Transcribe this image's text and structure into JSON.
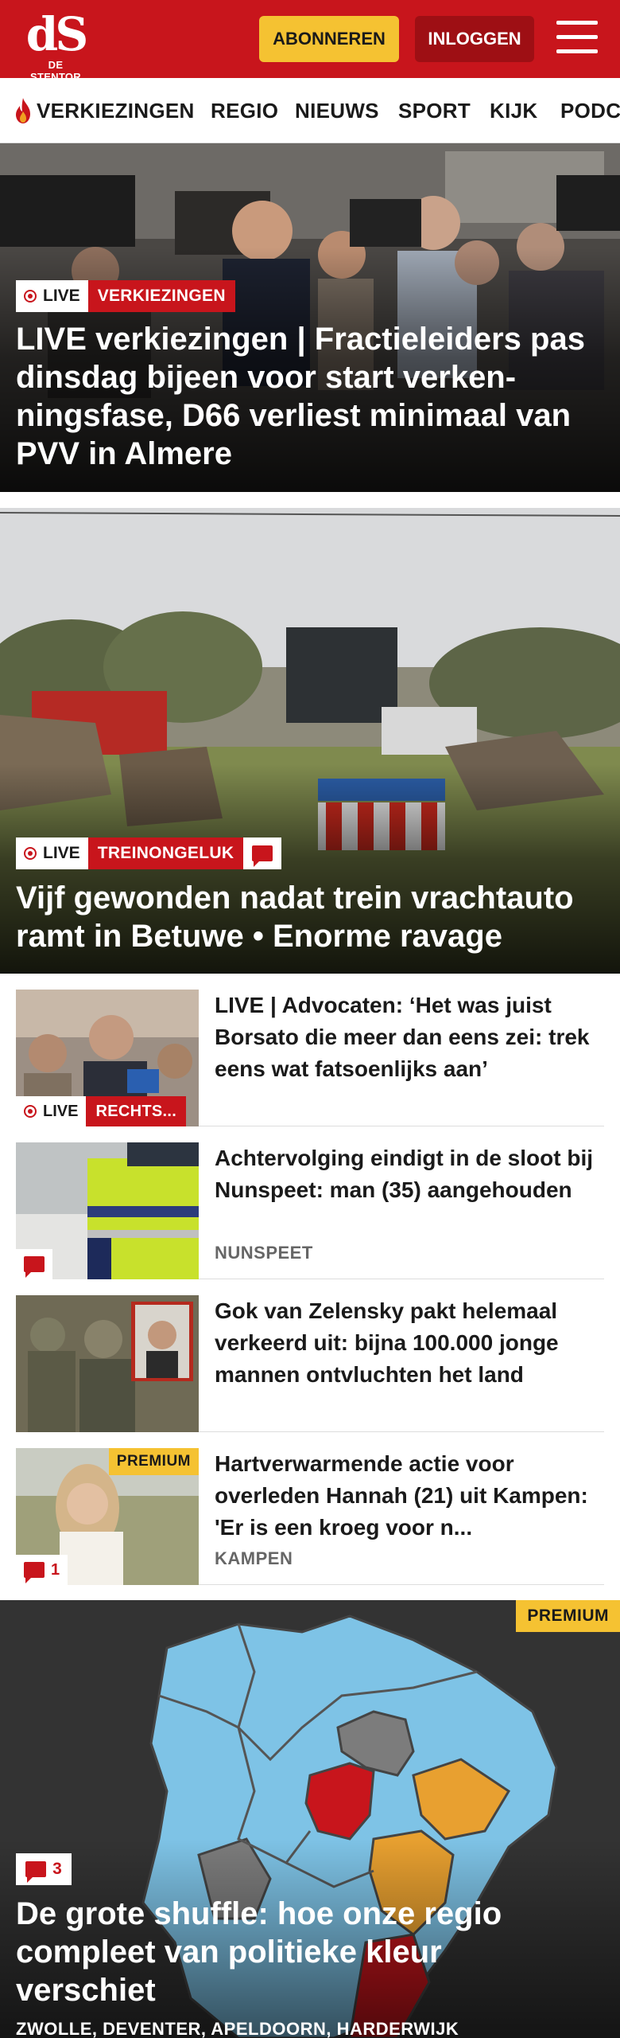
{
  "header": {
    "logo_mark": "dS",
    "logo_sub": "DE STENTOR",
    "subscribe_label": "ABONNEREN",
    "login_label": "INLOGGEN"
  },
  "nav": {
    "items": [
      "VERKIEZINGEN",
      "REGIO",
      "NIEUWS",
      "SPORT",
      "KIJK",
      "PODC"
    ]
  },
  "hero1": {
    "live_label": "LIVE",
    "category": "VERKIEZINGEN",
    "title": "LIVE verkiezingen | Fractieleiders pas dinsdag bijeen voor start verken­ningsfase, D66 verliest minimaal van PVV in Almere"
  },
  "hero2": {
    "live_label": "LIVE",
    "category": "TREINONGELUK",
    "title": "Vijf gewonden nadat trein vrachtauto ramt in Betuwe • Enorme ravage",
    "icon": "comment-icon"
  },
  "articles": [
    {
      "headline": "LIVE | Advocaten: ‘Het was juist Borsato die meer dan eens zei: trek eens wat fatsoenlijks aan’",
      "live_label": "LIVE",
      "category": "RECHTS..."
    },
    {
      "headline": "Achtervolging eindigt in de sloot bij Nunspeet: man (35) aangehou­den",
      "location": "NUNSPEET"
    },
    {
      "headline": "Gok van Zelensky pakt helemaal verkeerd uit: bijna 100.000 jonge mannen ontvluchten het land"
    },
    {
      "headline": "Hartverwarmende actie voor overleden Hannah (21) uit Kampen: 'Er is een kroeg voor n...",
      "location": "KAMPEN",
      "premium": "PREMIUM",
      "comments": "1"
    }
  ],
  "mapcard": {
    "premium": "PREMIUM",
    "comments": "3",
    "title": "De grote shuffle: hoe onze regio compleet van politieke kleur verschiet",
    "locations": "ZWOLLE, DEVENTER, APELDOORN, HARDERWIJK"
  },
  "colors": {
    "brand_red": "#c8151c",
    "premium_yellow": "#f5c232",
    "map_blue": "#7ec3e6",
    "map_orange": "#e8a030",
    "map_red": "#c8151c",
    "map_grey": "#7c7c7c"
  }
}
